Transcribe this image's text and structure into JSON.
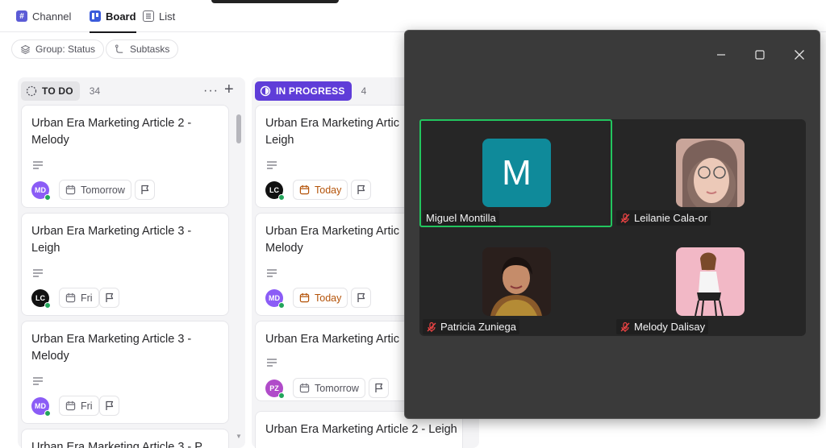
{
  "tabs": [
    {
      "label": "Channel",
      "icon": "hash-icon"
    },
    {
      "label": "Board",
      "icon": "board-icon"
    },
    {
      "label": "List",
      "icon": "list-icon"
    }
  ],
  "filters": {
    "group": "Group: Status",
    "subtasks": "Subtasks"
  },
  "columns": [
    {
      "status": "TO DO",
      "count": "34",
      "cards": [
        {
          "title": "Urban Era Marketing Article 2 - Melody",
          "assignee": "MD",
          "date": "Tomorrow"
        },
        {
          "title": "Urban Era Marketing Article 3 - Leigh",
          "assignee": "LC",
          "date": "Fri"
        },
        {
          "title": "Urban Era Marketing Article 3 - Melody",
          "assignee": "MD",
          "date": "Fri"
        },
        {
          "title": "Urban Era Marketing Article 3 - P...",
          "assignee": "",
          "date": ""
        }
      ]
    },
    {
      "status": "IN PROGRESS",
      "count": "4",
      "cards": [
        {
          "title": "Urban Era Marketing Artic Leigh",
          "assignee": "LC",
          "date": "Today"
        },
        {
          "title": "Urban Era Marketing Artic Melody",
          "assignee": "MD",
          "date": "Today"
        },
        {
          "title": "Urban Era Marketing Artic",
          "assignee": "PZ",
          "date": "Tomorrow"
        },
        {
          "title": "Urban Era Marketing Article 2 - Leigh",
          "assignee": "",
          "date": ""
        }
      ]
    }
  ],
  "call": {
    "participants": [
      {
        "name": "Miguel Montilla",
        "initial": "M",
        "muted": false,
        "active": true
      },
      {
        "name": "Leilanie Cala-or",
        "muted": true
      },
      {
        "name": "Patricia Zuniega",
        "muted": true
      },
      {
        "name": "Melody Dalisay",
        "muted": true
      }
    ]
  },
  "colors": {
    "todo": "#52525b",
    "inprogress": "#5f3dd8",
    "today": "#b45309",
    "call_bg": "#3a3a3a",
    "active_border": "#22c55e"
  }
}
